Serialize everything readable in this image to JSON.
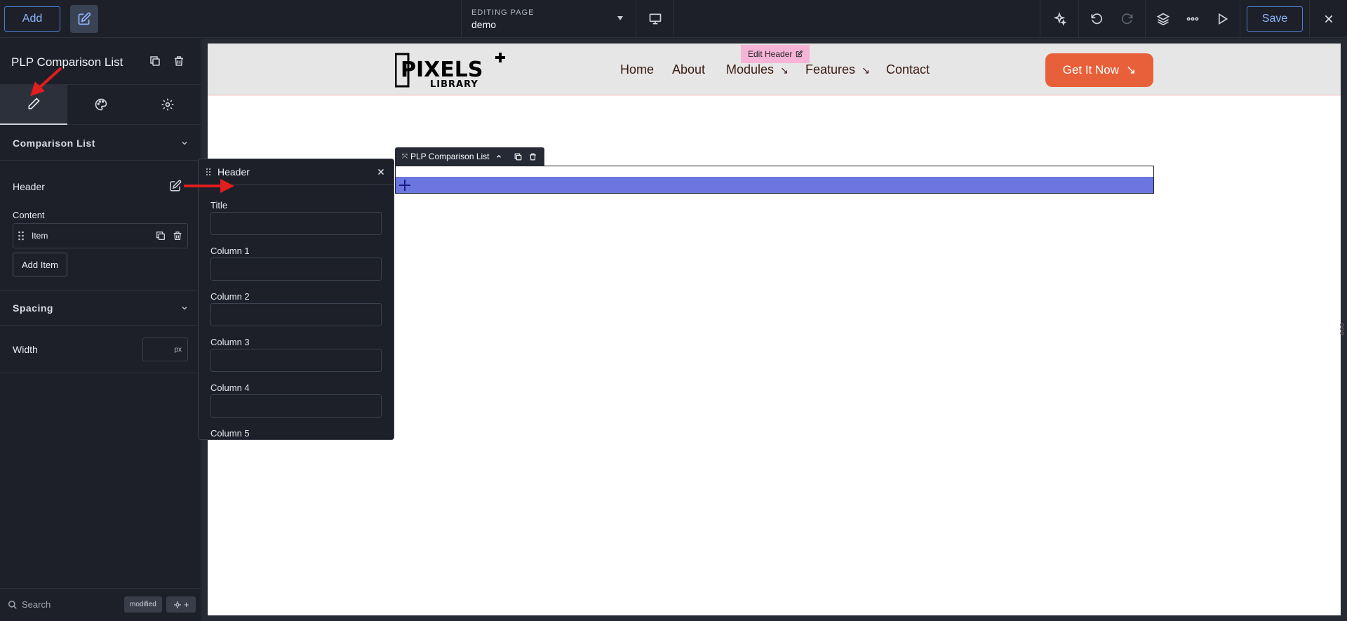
{
  "topbar": {
    "add_label": "Add",
    "editing_label": "EDITING PAGE",
    "editing_page": "demo",
    "save_label": "Save"
  },
  "sidebar": {
    "module_title": "PLP Comparison List",
    "section_comparison": "Comparison List",
    "header_label": "Header",
    "content_label": "Content",
    "item_label": "Item",
    "add_item_label": "Add Item",
    "section_spacing": "Spacing",
    "width_label": "Width",
    "width_value": "",
    "width_unit": "px",
    "search_placeholder": "Search",
    "modified_badge": "modified"
  },
  "site": {
    "logo_top": "PIXELS",
    "logo_bottom": "LIBRARY",
    "nav": [
      "Home",
      "About",
      "Modules",
      "Features",
      "Contact"
    ],
    "cta_label": "Get It Now",
    "edit_header_label": "Edit Header"
  },
  "canvas": {
    "module_tag_label": "PLP Comparison List"
  },
  "panel": {
    "title": "Header",
    "fields": [
      "Title",
      "Column 1",
      "Column 2",
      "Column 3",
      "Column 4",
      "Column 5"
    ]
  },
  "colors": {
    "accent_blue": "#4e7fd1",
    "cta_orange": "#e8603a",
    "module_bar": "#6b76e0",
    "edit_header_pink": "#f7b4d6",
    "annotation_red": "#e11d1d"
  }
}
